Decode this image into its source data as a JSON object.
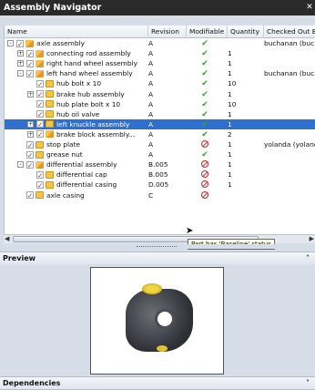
{
  "window": {
    "title": "Assembly Navigator",
    "close_glyph": "✕"
  },
  "columns": {
    "name": "Name",
    "revision": "Revision",
    "modifiable": "Modifiable",
    "quantity": "Quantity",
    "checked_out_by": "Checked Out By"
  },
  "rows": [
    {
      "name": "axle assembly",
      "revision": "A",
      "modifiable": "yes",
      "quantity": "",
      "checked_out_by": "buchanan (buc...",
      "expander": "-",
      "indent": 0,
      "icon": "assembly-icon"
    },
    {
      "name": "connecting rod assembly",
      "revision": "A",
      "modifiable": "yes",
      "quantity": "1",
      "checked_out_by": "",
      "expander": "+",
      "indent": 1,
      "icon": "assembly-icon"
    },
    {
      "name": "right hand wheel assembly",
      "revision": "A",
      "modifiable": "yes",
      "quantity": "1",
      "checked_out_by": "",
      "expander": "+",
      "indent": 1,
      "icon": "assembly-icon"
    },
    {
      "name": "left hand wheel assembly",
      "revision": "A",
      "modifiable": "yes",
      "quantity": "1",
      "checked_out_by": "buchanan (buc...",
      "expander": "-",
      "indent": 1,
      "icon": "assembly-icon"
    },
    {
      "name": "hub bolt x 10",
      "revision": "A",
      "modifiable": "yes",
      "quantity": "10",
      "checked_out_by": "",
      "expander": "",
      "indent": 2,
      "icon": "part-icon"
    },
    {
      "name": "brake hub assembly",
      "revision": "A",
      "modifiable": "yes",
      "quantity": "1",
      "checked_out_by": "",
      "expander": "+",
      "indent": 2,
      "icon": "part-icon"
    },
    {
      "name": "hub plate bolt x 10",
      "revision": "A",
      "modifiable": "yes",
      "quantity": "10",
      "checked_out_by": "",
      "expander": "",
      "indent": 2,
      "icon": "part-icon"
    },
    {
      "name": "hub oil valve",
      "revision": "A",
      "modifiable": "yes",
      "quantity": "1",
      "checked_out_by": "",
      "expander": "",
      "indent": 2,
      "icon": "part-icon"
    },
    {
      "name": "left knuckle assembly",
      "revision": "A",
      "modifiable": "yes",
      "quantity": "1",
      "checked_out_by": "",
      "expander": "+",
      "indent": 2,
      "icon": "part-icon",
      "selected": true
    },
    {
      "name": "brake block assembly...",
      "revision": "A",
      "modifiable": "yes",
      "quantity": "2",
      "checked_out_by": "",
      "expander": "+",
      "indent": 2,
      "icon": "assembly-icon"
    },
    {
      "name": "stop plate",
      "revision": "A",
      "modifiable": "no",
      "quantity": "1",
      "checked_out_by": "yolanda (yolanda",
      "expander": "",
      "indent": 1,
      "icon": "part-icon"
    },
    {
      "name": "grease nut",
      "revision": "A",
      "modifiable": "yes",
      "quantity": "1",
      "checked_out_by": "",
      "expander": "",
      "indent": 1,
      "icon": "part-icon"
    },
    {
      "name": "differential assembly",
      "revision": "B.005",
      "modifiable": "no",
      "quantity": "1",
      "checked_out_by": "",
      "expander": "-",
      "indent": 1,
      "icon": "assembly-icon"
    },
    {
      "name": "differential cap",
      "revision": "B.005",
      "modifiable": "no",
      "quantity": "1",
      "checked_out_by": "",
      "expander": "",
      "indent": 2,
      "icon": "part-icon"
    },
    {
      "name": "differential casing",
      "revision": "D.005",
      "modifiable": "no",
      "quantity": "1",
      "checked_out_by": "",
      "expander": "",
      "indent": 2,
      "icon": "part-icon"
    },
    {
      "name": "axle casing",
      "revision": "C",
      "modifiable": "no",
      "quantity": "",
      "checked_out_by": "",
      "expander": "",
      "indent": 1,
      "icon": "part-icon"
    }
  ],
  "tooltip": "Part has 'Baseline' status",
  "preview": {
    "title": "Preview",
    "arrow": "˄"
  },
  "dependencies": {
    "title": "Dependencies",
    "arrow": "˅"
  }
}
